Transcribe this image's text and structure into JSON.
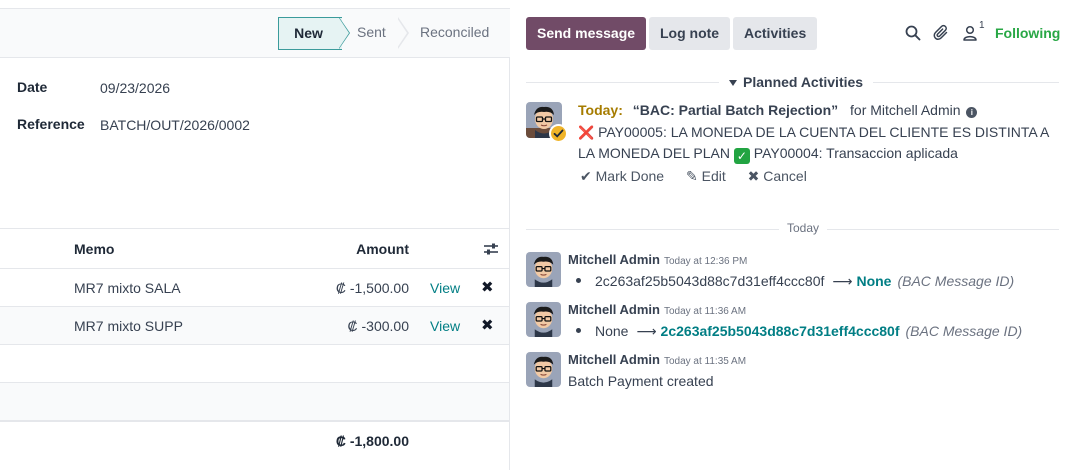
{
  "statusbar": {
    "stages": [
      {
        "label": "New",
        "active": true
      },
      {
        "label": "Sent",
        "active": false
      },
      {
        "label": "Reconciled",
        "active": false
      }
    ]
  },
  "form": {
    "date_label": "Date",
    "date_value": "09/23/2026",
    "reference_label": "Reference",
    "reference_value": "BATCH/OUT/2026/0002"
  },
  "lines": {
    "headers": {
      "memo": "Memo",
      "amount": "Amount"
    },
    "rows": [
      {
        "memo": "MR7 mixto SALA",
        "amount": "₡ -1,500.00",
        "action": "View"
      },
      {
        "memo": "MR7 mixto SUPP",
        "amount": "₡ -300.00",
        "action": "View"
      }
    ],
    "total": "₡ -1,800.00"
  },
  "chatter": {
    "buttons": {
      "send": "Send message",
      "log": "Log note",
      "activities": "Activities"
    },
    "follower_count": "1",
    "following_label": "Following",
    "planned_activities_label": "Planned Activities",
    "activity": {
      "due": "Today:",
      "summary": "“BAC: Partial Batch Rejection”",
      "for": "for Mitchell Admin",
      "note_part1": "PAY00005: LA MONEDA DE LA CUENTA DEL CLIENTE ES DISTINTA A LA MONEDA DEL PLAN",
      "note_part2": "PAY00004: Transaccion aplicada",
      "mark_done": "Mark Done",
      "edit": "Edit",
      "cancel": "Cancel"
    },
    "day_separator": "Today",
    "messages": [
      {
        "author": "Mitchell Admin",
        "time": "Today at 12:36 PM",
        "old": "2c263af25b5043d88c7d31eff4ccc80f",
        "new": "None",
        "field": "(BAC Message ID)"
      },
      {
        "author": "Mitchell Admin",
        "time": "Today at 11:36 AM",
        "old": "None",
        "new": "2c263af25b5043d88c7d31eff4ccc80f",
        "field": "(BAC Message ID)"
      },
      {
        "author": "Mitchell Admin",
        "time": "Today at 11:35 AM",
        "body": "Batch Payment created"
      }
    ]
  },
  "colors": {
    "primary": "#714b67",
    "link": "#017e84",
    "following": "#28a745",
    "today": "#a67c00"
  }
}
